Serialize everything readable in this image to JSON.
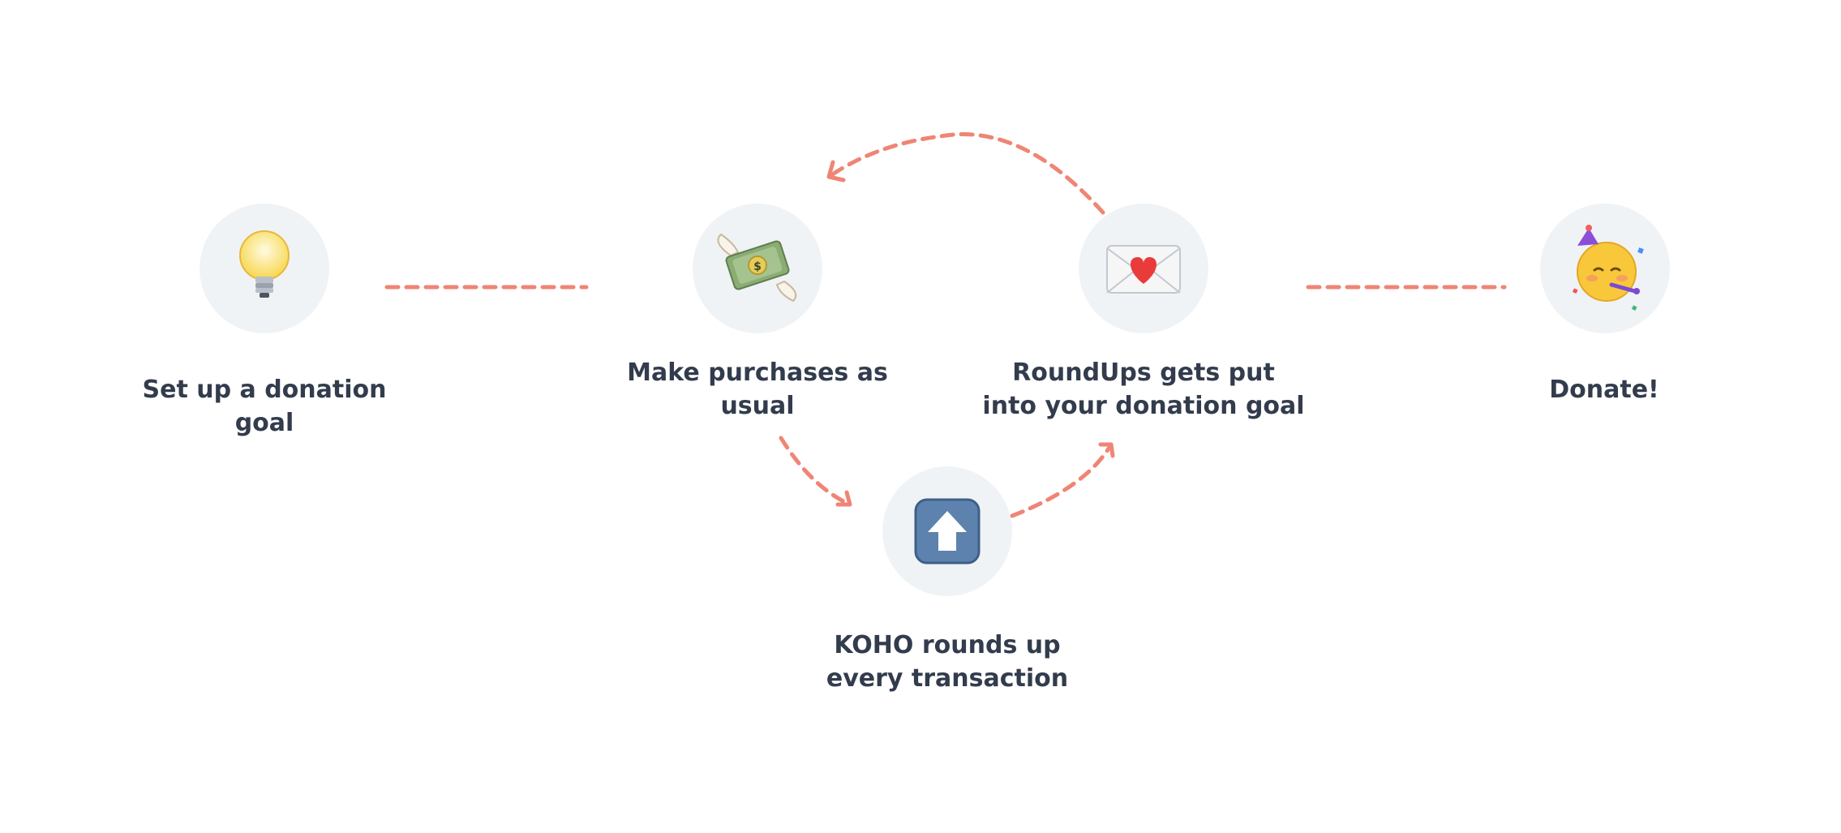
{
  "colors": {
    "background": "#ffffff",
    "node_fill": "#f0f3f6",
    "connector": "#ef8575",
    "text": "#333c4d"
  },
  "steps": [
    {
      "icon": "lightbulb-icon",
      "label": "Set up a donation\ngoal"
    },
    {
      "icon": "money-with-wings-icon",
      "label": "Make purchases as\nusual"
    },
    {
      "icon": "up-arrow-icon",
      "label": "KOHO rounds up\nevery transaction"
    },
    {
      "icon": "love-letter-icon",
      "label": "RoundUps gets put\ninto your donation goal"
    },
    {
      "icon": "partying-face-icon",
      "label": "Donate!"
    }
  ]
}
